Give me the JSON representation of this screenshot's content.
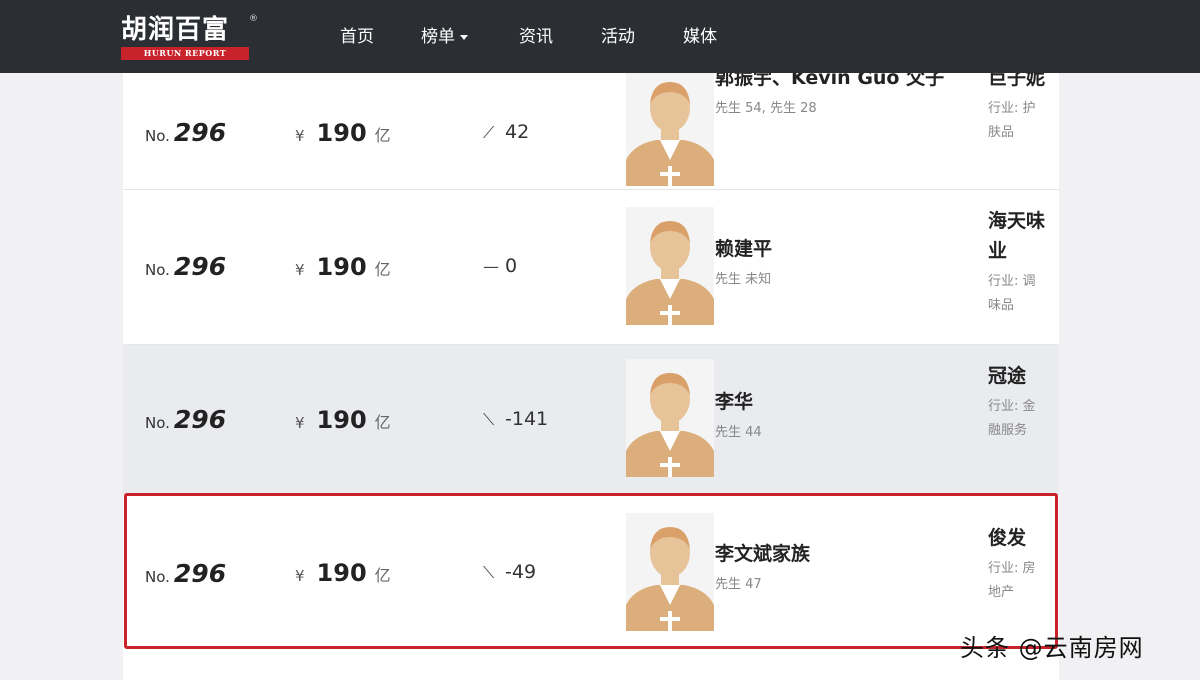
{
  "header": {
    "logo_text": "胡润百富",
    "logo_reg": "®",
    "logo_sub": "HURUN REPORT",
    "nav": [
      {
        "label": "首页"
      },
      {
        "label": "榜单"
      },
      {
        "label": "资讯"
      },
      {
        "label": "活动"
      },
      {
        "label": "媒体"
      }
    ]
  },
  "rows": [
    {
      "rank_prefix": "No.",
      "rank": "296",
      "currency": "¥",
      "wealth": "190",
      "unit": "亿",
      "change_icon": "trend-up",
      "change": "42",
      "name": "郭振宇、Kevin Guo 父子",
      "meta": "先生 54, 先生 28",
      "company": "巨子妮",
      "industry": "行业: 护肤品"
    },
    {
      "rank_prefix": "No.",
      "rank": "296",
      "currency": "¥",
      "wealth": "190",
      "unit": "亿",
      "change_icon": "trend-flat",
      "change": "0",
      "name": "赖建平",
      "meta": "先生 未知",
      "company": "海天味业",
      "industry": "行业: 调味品"
    },
    {
      "rank_prefix": "No.",
      "rank": "296",
      "currency": "¥",
      "wealth": "190",
      "unit": "亿",
      "change_icon": "trend-down",
      "change": "-141",
      "name": "李华",
      "meta": "先生 44",
      "company": "冠途",
      "industry": "行业: 金融服务"
    },
    {
      "rank_prefix": "No.",
      "rank": "296",
      "currency": "¥",
      "wealth": "190",
      "unit": "亿",
      "change_icon": "trend-down",
      "change": "-49",
      "name": "李文斌家族",
      "meta": "先生 47",
      "company": "俊发",
      "industry": "行业: 房地产"
    }
  ],
  "watermark": "头条 @云南房网",
  "colors": {
    "topbar": "#2b2e33",
    "brand_red": "#c8232b",
    "row_alt": "#e9ebee",
    "avatar_skin": "#e7c39a",
    "avatar_body": "#dcae7c"
  }
}
